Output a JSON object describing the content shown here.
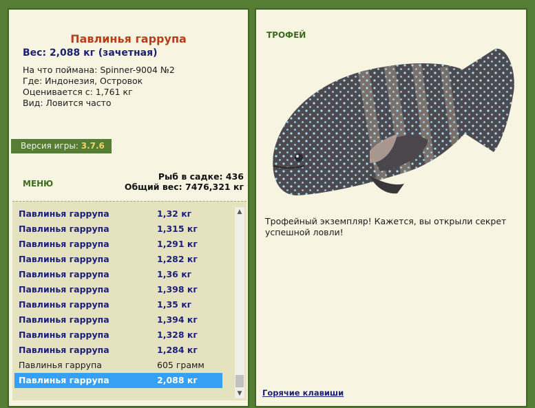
{
  "fish": {
    "title": "Павлинья гаррупа",
    "weight_line": "Вес: 2,088 кг (зачетная)",
    "caught_with": "На что поймана: Spinner-9004 №2",
    "location": "Где: Индонезия, Островок",
    "valued_from": "Оценивается с: 1,761 кг",
    "kind": "Вид: Ловится часто"
  },
  "version": {
    "label": "Версия игры:",
    "value": "3.7.6"
  },
  "menu_label": "МЕНЮ",
  "stats": {
    "fish_in_keepnet": "Рыб в садке: 436",
    "total_weight": "Общий вес: 7476,321 кг"
  },
  "catch_list": [
    {
      "name": "Павлинья гаррупа",
      "weight": "1,32 кг"
    },
    {
      "name": "Павлинья гаррупа",
      "weight": "1,315 кг"
    },
    {
      "name": "Павлинья гаррупа",
      "weight": "1,291 кг"
    },
    {
      "name": "Павлинья гаррупа",
      "weight": "1,282 кг"
    },
    {
      "name": "Павлинья гаррупа",
      "weight": "1,36 кг"
    },
    {
      "name": "Павлинья гаррупа",
      "weight": "1,398 кг"
    },
    {
      "name": "Павлинья гаррупа",
      "weight": "1,35 кг"
    },
    {
      "name": "Павлинья гаррупа",
      "weight": "1,394 кг"
    },
    {
      "name": "Павлинья гаррупа",
      "weight": "1,328 кг"
    },
    {
      "name": "Павлинья гаррупа",
      "weight": "1,284 кг"
    },
    {
      "name": "Павлинья гаррупа",
      "weight": "605 грамм"
    },
    {
      "name": "Павлинья гаррупа",
      "weight": "2,088 кг"
    }
  ],
  "trophy": {
    "label": "ТРОФЕЙ",
    "text": "Трофейный экземпляр! Кажется, вы открыли секрет успешной ловли!"
  },
  "hotkeys_label": "Горячие клавиши",
  "icons": {
    "scroll_up": "chevron-up-icon",
    "scroll_down": "chevron-down-icon",
    "fish_image": "fish-image"
  },
  "colors": {
    "frame": "#557d33",
    "panel": "#f7f4e1",
    "title": "#b3401a",
    "list_text": "#1b1f7a",
    "selection": "#35a0f4"
  }
}
